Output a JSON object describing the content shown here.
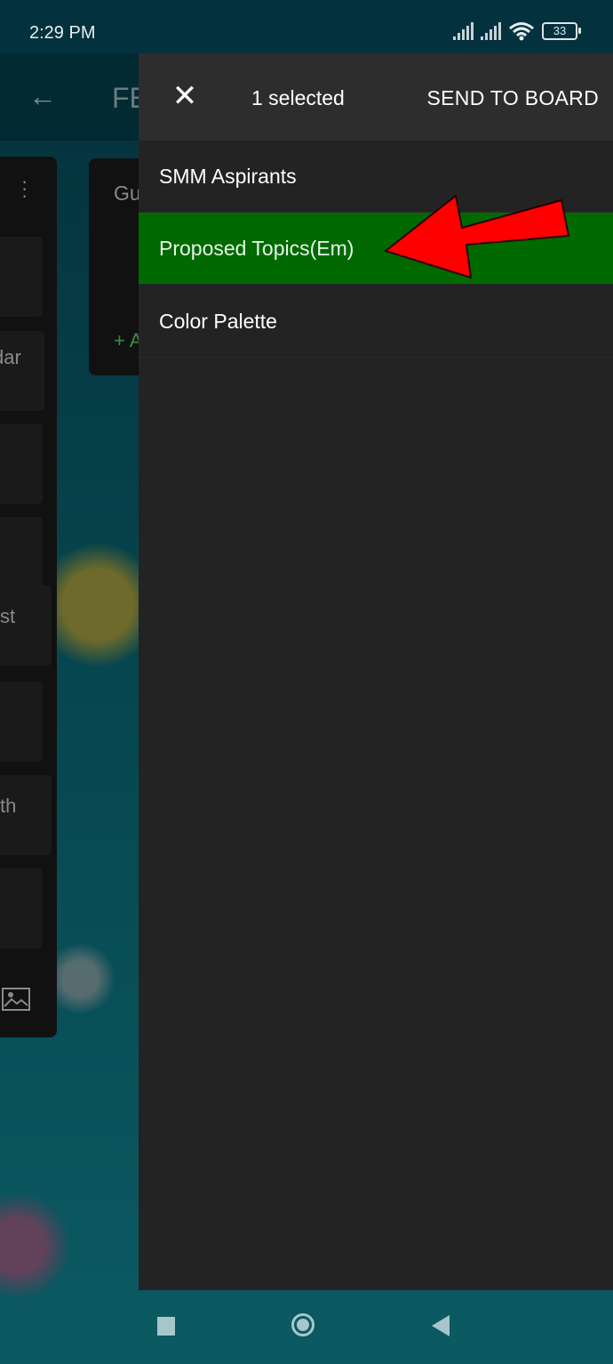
{
  "status_bar": {
    "time": "2:29 PM",
    "battery_level": "33",
    "icons": [
      "signal-icon",
      "signal-icon",
      "wifi-icon",
      "battery-icon"
    ]
  },
  "background_app": {
    "back_icon": "←",
    "board_title_partial": "FE",
    "column1_cards": [
      "dar",
      "st",
      "th"
    ],
    "column2_title_partial": "Gu",
    "column2_add_partial": "+ A",
    "image_icon": "image-icon"
  },
  "panel": {
    "close_icon": "✕",
    "selected_count": "1 selected",
    "send_to_board_label": "SEND TO BOARD",
    "boards": [
      {
        "label": "SMM Aspirants",
        "selected": false
      },
      {
        "label": "Proposed Topics(Em)",
        "selected": true
      },
      {
        "label": "Color Palette",
        "selected": false
      }
    ]
  },
  "colors": {
    "selected_row": "#006a00",
    "panel_bg": "#232323",
    "header_bg": "#2d2d2d",
    "annotation_arrow": "#ff0000"
  },
  "nav_bar": {
    "buttons": [
      "recent-apps",
      "home",
      "back"
    ]
  }
}
